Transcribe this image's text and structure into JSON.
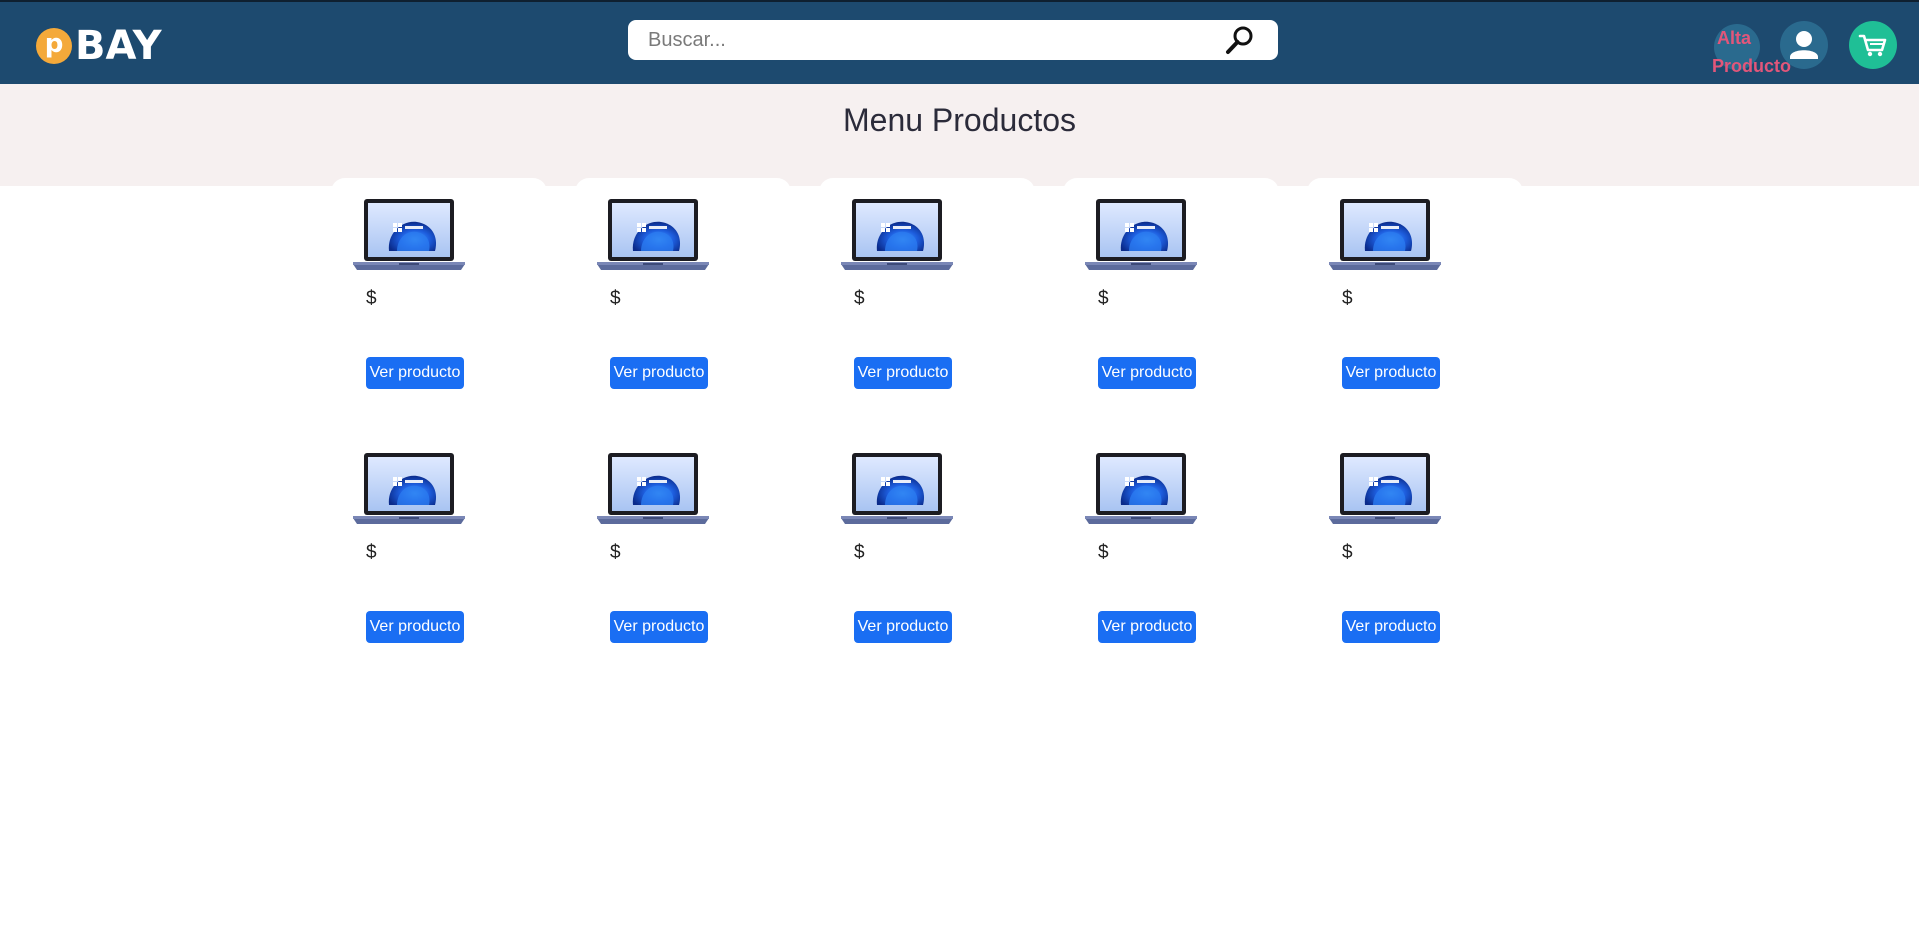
{
  "brand": {
    "letter": "p",
    "name": "BAY"
  },
  "search": {
    "placeholder": "Buscar..."
  },
  "header_actions": {
    "alta_line1": "Alta",
    "alta_line2": "Producto"
  },
  "page_title": "Menu Productos",
  "products": [
    {
      "price": "$",
      "button": "Ver producto"
    },
    {
      "price": "$",
      "button": "Ver producto"
    },
    {
      "price": "$",
      "button": "Ver producto"
    },
    {
      "price": "$",
      "button": "Ver producto"
    },
    {
      "price": "$",
      "button": "Ver producto"
    },
    {
      "price": "$",
      "button": "Ver producto"
    },
    {
      "price": "$",
      "button": "Ver producto"
    },
    {
      "price": "$",
      "button": "Ver producto"
    },
    {
      "price": "$",
      "button": "Ver producto"
    },
    {
      "price": "$",
      "button": "Ver producto"
    }
  ],
  "icons": {
    "search": "search-icon",
    "user": "user-icon",
    "cart": "cart-icon",
    "product_image": "laptop-image"
  },
  "colors": {
    "navbar": "#1d4a6f",
    "logo_coin": "#f4a93a",
    "alta_text": "#e2567a",
    "cart": "#1fbf96",
    "button": "#1a6ef3",
    "banner": "#f6f0f0"
  }
}
